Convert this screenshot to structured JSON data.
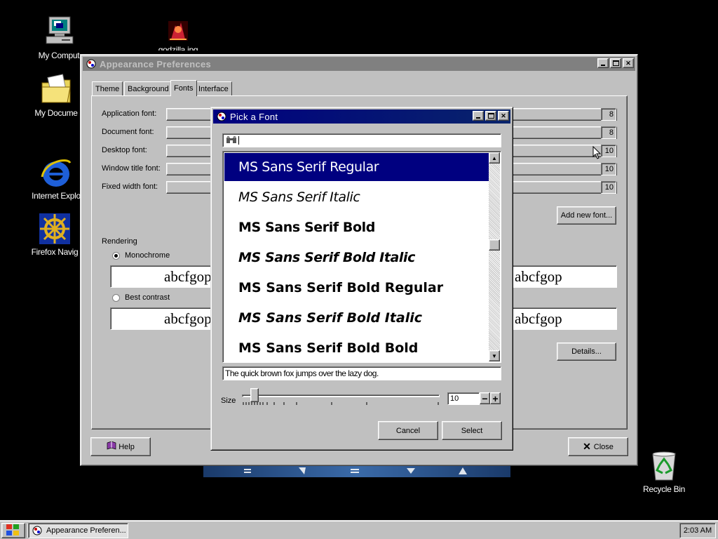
{
  "desktop": {
    "icons": [
      {
        "label": "My Comput",
        "icon": "computer-icon"
      },
      {
        "label": "godzilla.jpg",
        "icon": "image-file-icon"
      },
      {
        "label": "My Docume",
        "icon": "folder-icon"
      },
      {
        "label": "Internet Explo",
        "icon": "internet-explorer-icon"
      },
      {
        "label": "Firefox Navig",
        "icon": "ship-wheel-icon"
      },
      {
        "label": "Recycle Bin",
        "icon": "recycle-bin-icon"
      }
    ]
  },
  "appearance": {
    "title": "Appearance Preferences",
    "tabs": [
      "Theme",
      "Background",
      "Fonts",
      "Interface"
    ],
    "selected_tab": "Fonts",
    "font_rows": [
      {
        "label": "Application font:",
        "size": "8"
      },
      {
        "label": "Document font:",
        "size": "8"
      },
      {
        "label": "Desktop font:",
        "size": "10"
      },
      {
        "label": "Window title font:",
        "size": "10"
      },
      {
        "label": "Fixed width font:",
        "size": "10"
      }
    ],
    "add_font_button": "Add new font...",
    "rendering_label": "Rendering",
    "options": [
      {
        "label": "Monochrome",
        "selected": true
      },
      {
        "label": "Best contrast",
        "selected": false
      }
    ],
    "preview_left": "abcfgop",
    "preview_right": "abcfgop",
    "details_button": "Details...",
    "help_button": "Help",
    "close_button": "Close"
  },
  "dialog": {
    "title": "Pick a Font",
    "search_value": "",
    "fonts": [
      "MS Sans Serif Regular",
      "MS Sans Serif Italic",
      "MS Sans Serif Bold",
      "MS Sans Serif Bold Italic",
      "MS Sans Serif Bold Regular",
      "MS Sans Serif Bold Italic",
      "MS Sans Serif Bold Bold"
    ],
    "selected_index": 0,
    "preview_text": "The quick brown fox jumps over the lazy dog.",
    "size_label": "Size",
    "size_value": "10",
    "cancel_button": "Cancel",
    "select_button": "Select"
  },
  "taskbar": {
    "task_label": "Appearance Preferen...",
    "clock": "2:03 AM"
  },
  "colors": {
    "desktop": "#000000",
    "window_face": "#c0c0c0",
    "active_title": "#000080",
    "inactive_title": "#808080",
    "selection": "#000080"
  }
}
